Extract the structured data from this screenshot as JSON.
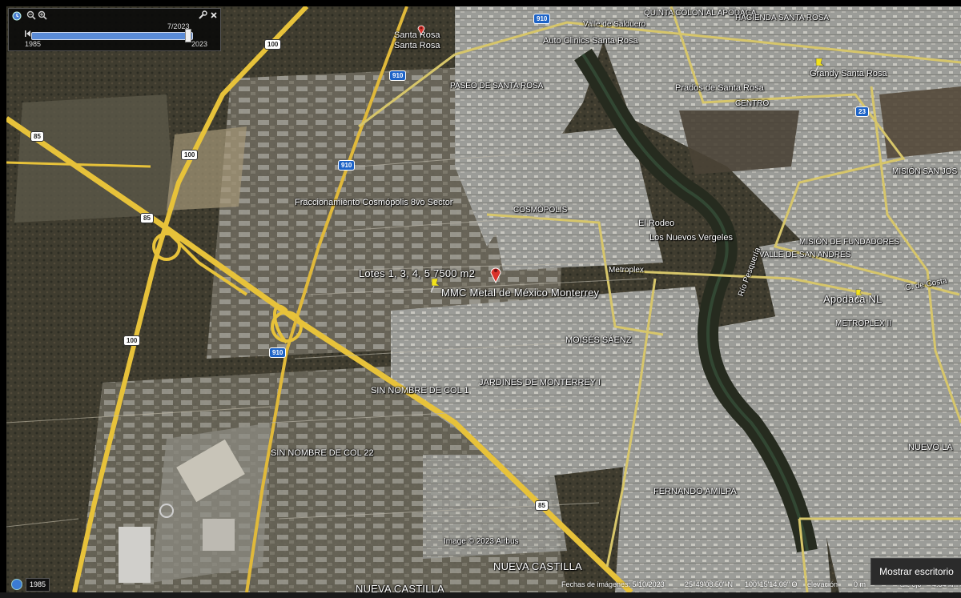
{
  "timeline": {
    "current_date": "7/2023",
    "start_year": "1985",
    "end_year": "2023",
    "progress": 0.97
  },
  "places": {
    "santa_rosa_pin_1": "Santa Rosa",
    "santa_rosa_pin_2": "Santa Rosa",
    "valle_de_salduero": "Valle de Salduero",
    "quinta_colonial": "QUINTA COLONIAL APODACA",
    "hacienda_santa_rosa": "HACIENDA SANTA ROSA",
    "auto_clinics": "Auto Clinics Santa Rosa",
    "grandy_santa_rosa": "Grandy Santa Rosa",
    "prados_santa_rosa": "Prados de Santa Rosa",
    "paseo_santa_rosa": "PASEO DE SANTA ROSA",
    "centro": "CENTRO",
    "mision_san_jose": "MISIÓN SAN JOS",
    "fraccionamiento": "Fraccionamiento Cosmópolis 8vo Sector",
    "cosmopolis": "COSMÓPOLIS",
    "el_rodeo": "El Rodeo",
    "nuevos_vergeles": "Los Nuevos Vergeles",
    "mision_fundadores": "MISIÓN DE FUNDADORES",
    "valle_san_andres": "VALLE DE SAN ANDRÉS",
    "lotes": "Lotes 1, 3, 4, 5 7500 m2",
    "mmc": "MMC Metal de México Monterrey",
    "metroplex": "Metroplex",
    "apodaca": "Apodaca NL",
    "metroplex_ii": "METROPLEX II",
    "moises_saenz": "MOISÉS SÁENZ",
    "jardines": "JARDINES DE MONTERREY I",
    "sin_nombre_1": "SIN NOMBRE DE COL 1",
    "sin_nombre_22": "SIN NOMBRE DE COL 22",
    "fernando_amilpa": "FERNANDO AMILPA",
    "nuevo_la": "NUEVO LA",
    "nueva_castilla_1": "NUEVA CASTILLA",
    "nueva_castilla_2": "NUEVA CASTILLA",
    "rio_pesqueria": "Río Pesquería",
    "calle_costa": "C. de Costa"
  },
  "shields": {
    "s100_a": "100",
    "s100_b": "100",
    "s100_c": "100",
    "s910_a": "910",
    "s910_b": "910",
    "s910_c": "910",
    "s910_d": "910",
    "s85_a": "85",
    "s85_b": "85",
    "s85_c": "85",
    "s23": "23"
  },
  "status_bar": {
    "imagery_credit": "Image © 2023 Airbus",
    "imagery_date": "Fechas de imágenes: 5/10/2023",
    "latitude": "25°49'08.50\" N",
    "longitude": "100°15'14.09\" O",
    "elevation": "elevación",
    "elevation_value": "0 m",
    "eye_alt": "alt. ojo",
    "eye_alt_value": "4.64 km",
    "year_badge": "1985"
  },
  "tooltip": "Mostrar escritorio",
  "colors": {
    "highway": "#e7c23a",
    "secondary_road": "#d7c66a",
    "shield_blue": "#1d63c7",
    "pin_red": "#d9322b",
    "pushpin_yellow": "#f3e31a"
  },
  "icons": {
    "clock": "clock-icon",
    "zoom_out": "zoom-out-icon",
    "zoom_in": "zoom-in-icon",
    "wrench": "wrench-icon",
    "close": "close-icon"
  }
}
